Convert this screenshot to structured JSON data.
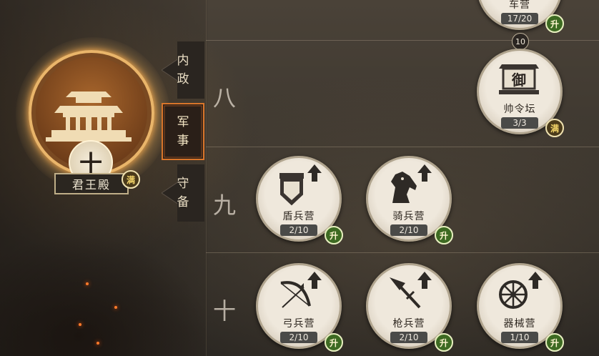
{
  "palace": {
    "name": "君王殿",
    "level_char": "十",
    "status_badge": "满"
  },
  "tabs": [
    {
      "label_top": "内",
      "label_bottom": "政",
      "active": false
    },
    {
      "label_top": "军",
      "label_bottom": "事",
      "active": true
    },
    {
      "label_top": "守",
      "label_bottom": "备",
      "active": false
    }
  ],
  "rows": {
    "eight": "八",
    "nine": "九",
    "ten": "十"
  },
  "connector_level": "10",
  "buildings": {
    "chariot": {
      "name": "车营",
      "count": "17/20",
      "badge": "升"
    },
    "command": {
      "name": "帅令坛",
      "count": "3/3",
      "badge": "满",
      "icon_text": "御"
    },
    "shield": {
      "name": "盾兵营",
      "count": "2/10",
      "badge": "升"
    },
    "cavalry": {
      "name": "骑兵营",
      "count": "2/10",
      "badge": "升"
    },
    "archer": {
      "name": "弓兵营",
      "count": "2/10",
      "badge": "升"
    },
    "spear": {
      "name": "枪兵营",
      "count": "2/10",
      "badge": "升"
    },
    "siege": {
      "name": "器械营",
      "count": "1/10",
      "badge": "升"
    }
  },
  "colors": {
    "upgrade_badge": "#3d6a22",
    "full_badge": "#4a3a1a",
    "active_tab_border": "#d9752a"
  }
}
